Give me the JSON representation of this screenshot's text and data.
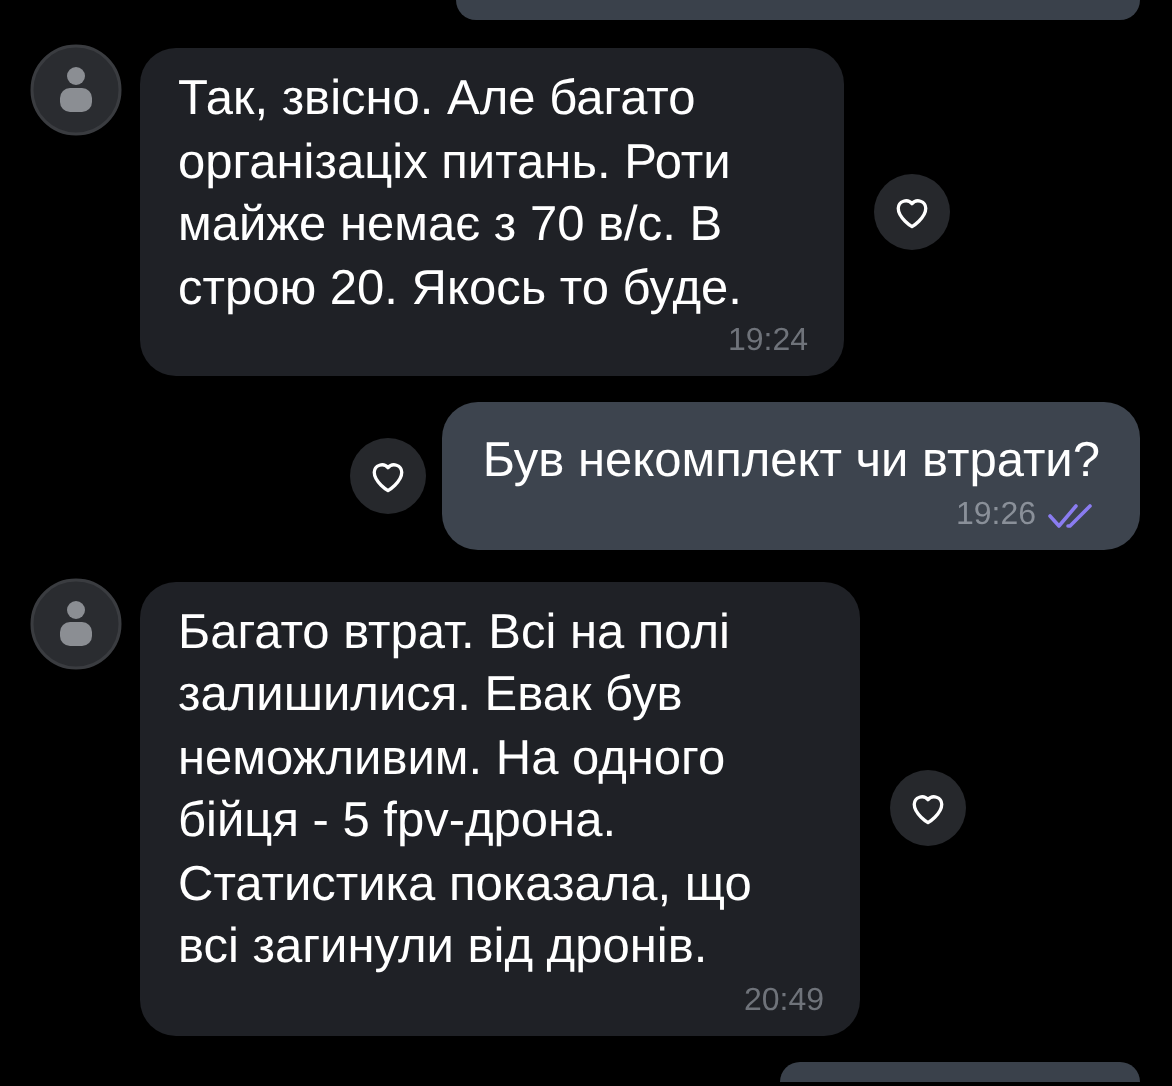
{
  "messages": [
    {
      "kind": "incoming",
      "text": "Так, звісно. Але багато організаціх питань. Роти майже немає з 70 в/с. В строю 20. Якось то буде.",
      "time": "19:24",
      "liked": false
    },
    {
      "kind": "outgoing",
      "text": "Був некомплект чи втрати?",
      "time": "19:26",
      "read": true,
      "liked": false
    },
    {
      "kind": "incoming",
      "text": "Багато втрат. Всі на полі залишилися. Евак був неможливим. На одного бійця - 5 fpv-дрона. Статистика показала, що всі загинули від дронів.",
      "time": "20:49",
      "liked": false
    }
  ]
}
